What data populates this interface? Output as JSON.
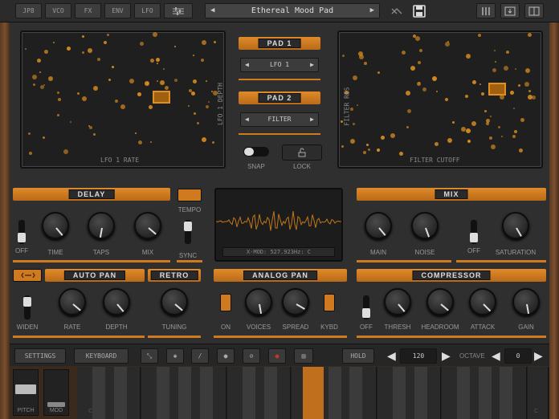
{
  "topbar": {
    "tabs": [
      "JP8",
      "VCO",
      "FX",
      "ENV",
      "LFO"
    ],
    "preset_name": "Ethereal Mood Pad",
    "prev_symbol": "◀",
    "next_symbol": "▶",
    "icons": [
      "sliders-icon",
      "shuffle-icon",
      "save-icon",
      "mixer-icon",
      "download-icon",
      "panel-icon"
    ]
  },
  "pads": {
    "pad1": {
      "title": "PAD 1",
      "source": "LFO 1",
      "x_label": "LFO 1 RATE",
      "y_label": "LFO 1 DEPTH"
    },
    "pad2": {
      "title": "PAD 2",
      "source": "FILTER",
      "x_label": "FILTER CUTOFF",
      "y_label": "FILTER RES"
    },
    "snap_label": "SNAP",
    "lock_label": "LOCK"
  },
  "delay": {
    "title": "DELAY",
    "switch_label": "OFF",
    "knobs": [
      "TIME",
      "TAPS",
      "MIX"
    ],
    "tempo_label": "TEMPO",
    "sync_label": "SYNC"
  },
  "scope": {
    "readout": "X-MOD: 527.923Hz: C"
  },
  "mix": {
    "title": "MIX",
    "knobs": [
      "MAIN",
      "NOISE"
    ],
    "switch_label": "OFF",
    "sat_label": "SATURATION"
  },
  "autopan": {
    "title": "AUTO PAN",
    "switch_label": "WIDEN",
    "knobs": [
      "RATE",
      "DEPTH"
    ]
  },
  "retro": {
    "title": "RETRO",
    "knob": "TUNING"
  },
  "analogpan": {
    "title": "ANALOG PAN",
    "on_label": "ON",
    "knobs": [
      "VOICES",
      "SPREAD"
    ],
    "kybd_label": "KYBD"
  },
  "compressor": {
    "title": "COMPRESSOR",
    "switch_label": "OFF",
    "knobs": [
      "THRESH",
      "HEADROOM",
      "ATTACK",
      "GAIN"
    ]
  },
  "bottombar": {
    "settings": "SETTINGS",
    "keyboard": "KEYBOARD",
    "hold": "HOLD",
    "tempo": "120",
    "octave_label": "OCTAVE",
    "octave_value": "0"
  },
  "keyboard": {
    "pitch_label": "PITCH",
    "mod_label": "MOD",
    "c_marks": [
      "C",
      "C"
    ]
  },
  "colors": {
    "accent": "#d58a20",
    "panel": "#2f2f2f",
    "wood": "#6a4428"
  }
}
